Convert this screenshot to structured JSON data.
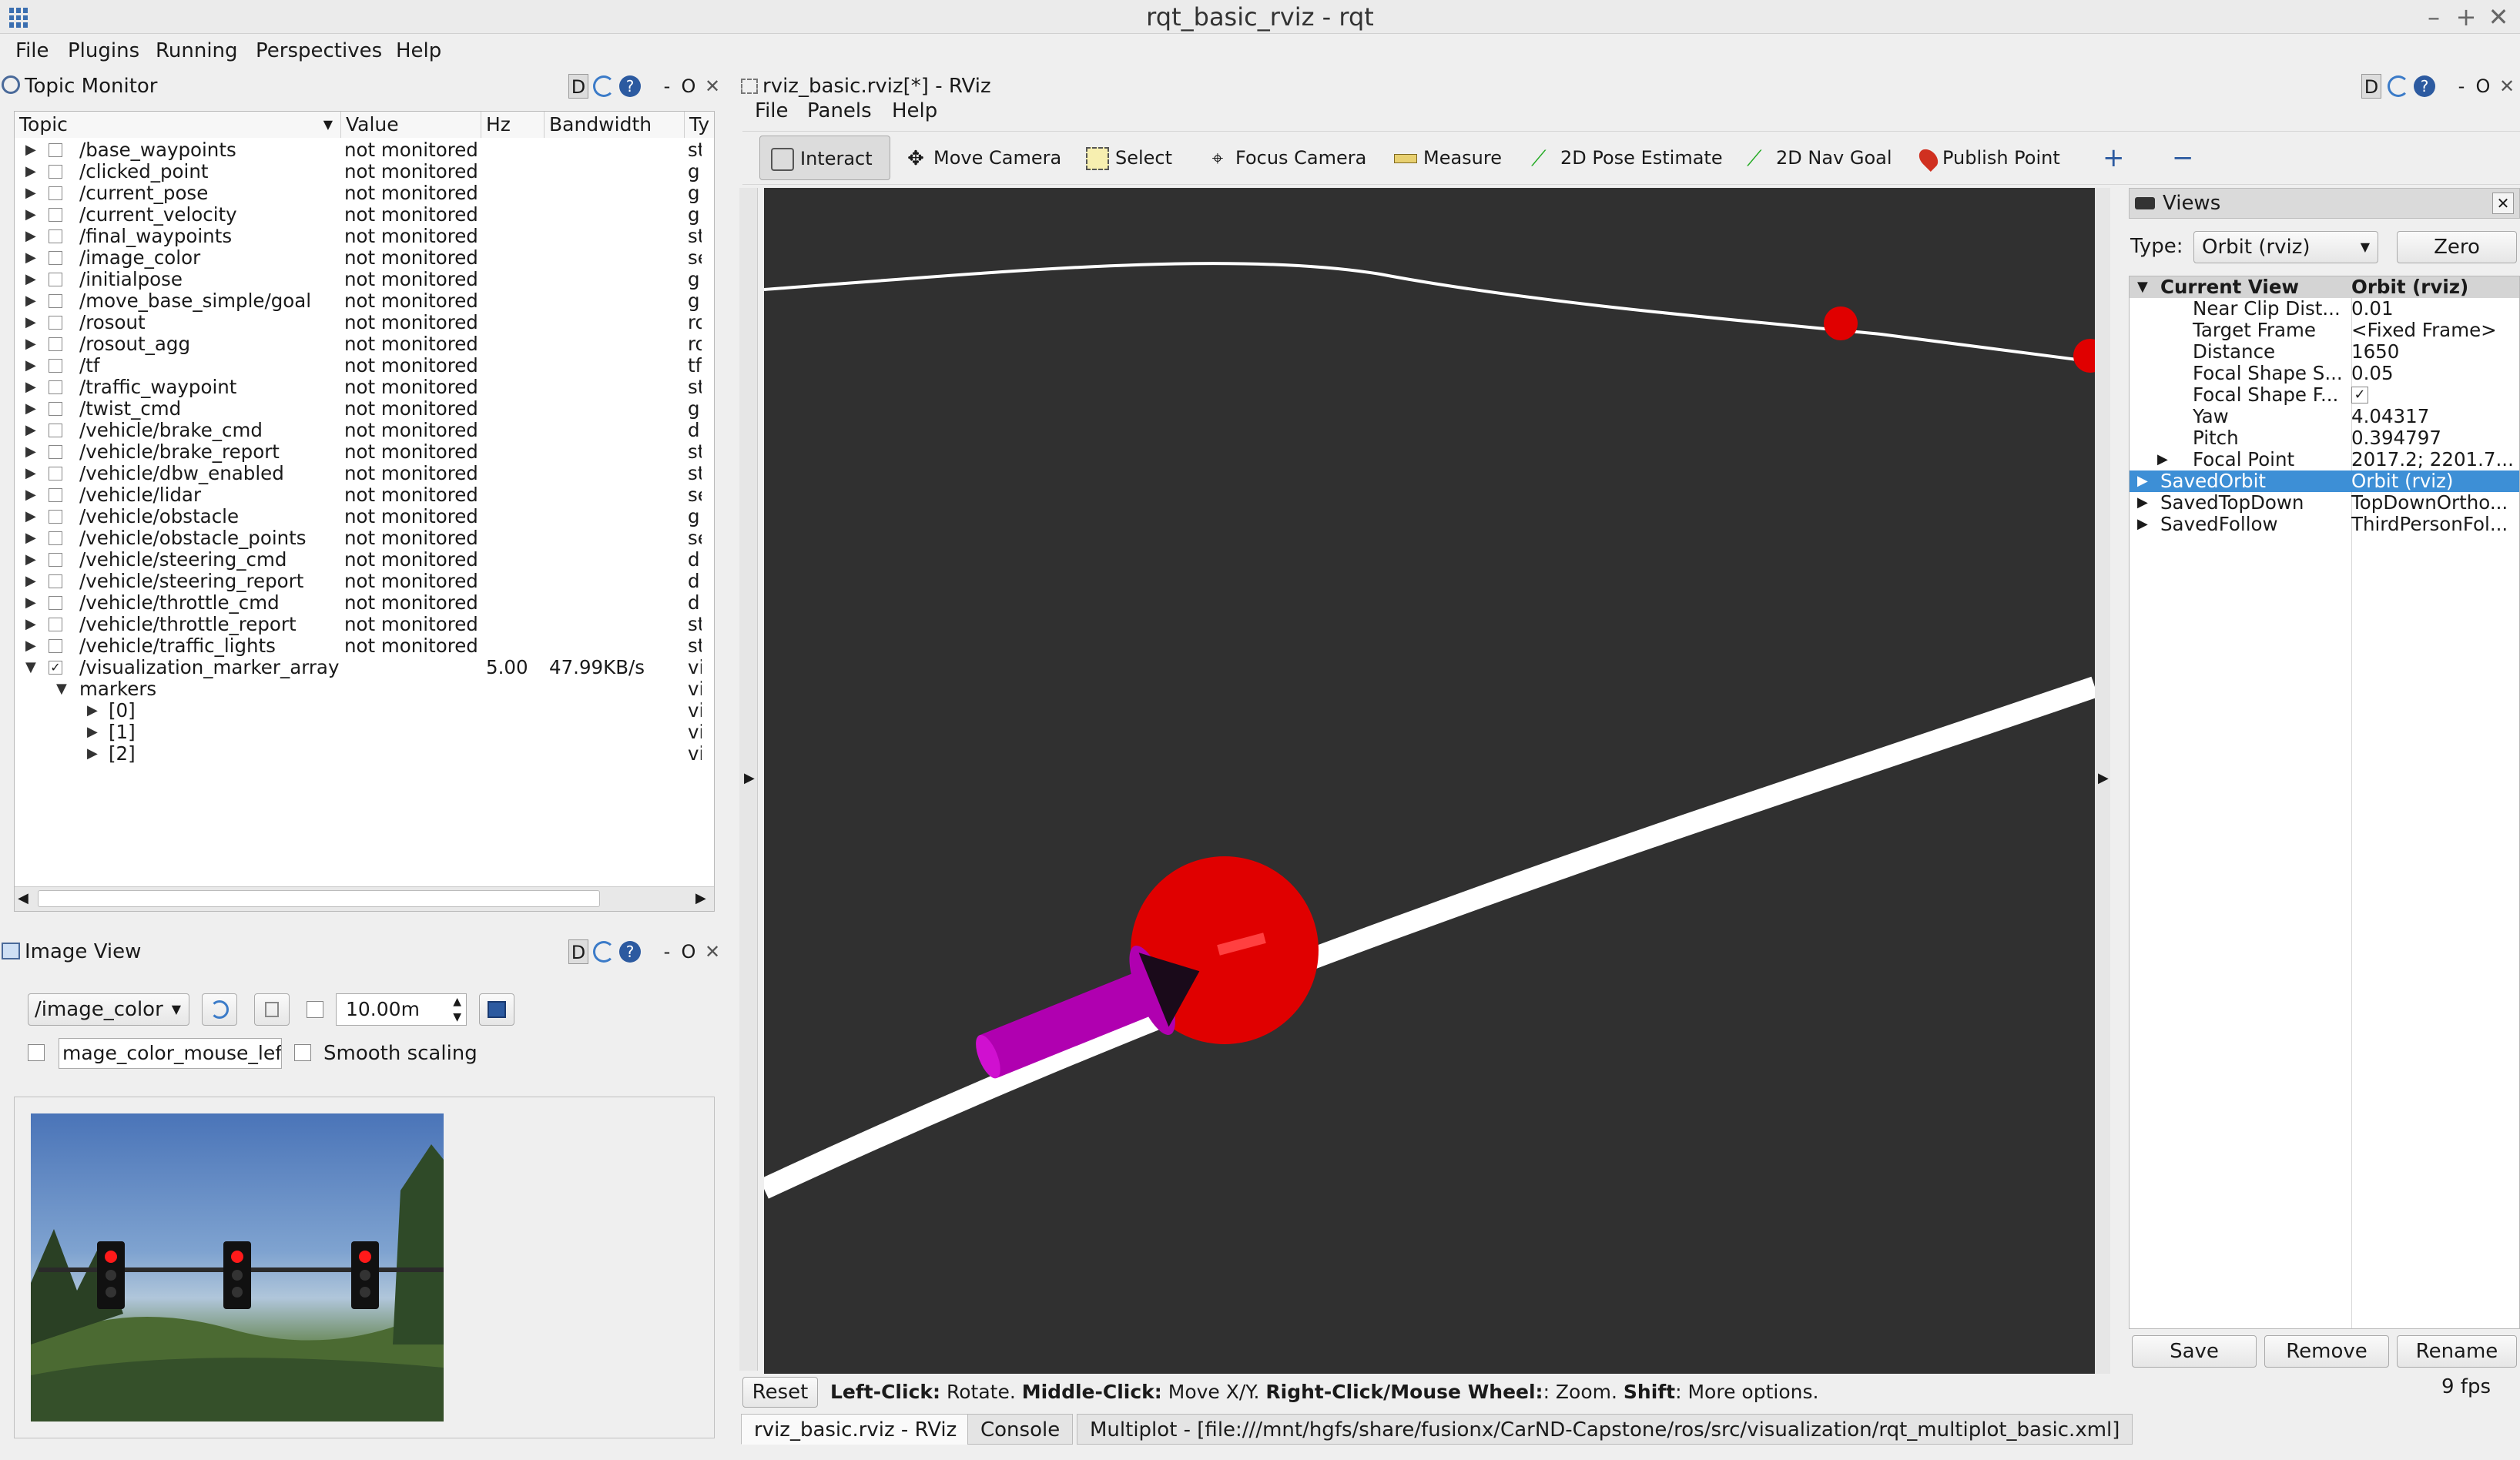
{
  "window": {
    "title": "rqt_basic_rviz - rqt",
    "min": "–",
    "max": "+",
    "close": "✕"
  },
  "menubar": {
    "file": "File",
    "plugins": "Plugins",
    "running": "Running",
    "perspectives": "Perspectives",
    "help": "Help"
  },
  "topic_monitor": {
    "title": "Topic Monitor",
    "dock_d": "D",
    "dock_dash": "-",
    "dock_o": "O",
    "columns": {
      "topic": "Topic",
      "value": "Value",
      "hz": "Hz",
      "bandwidth": "Bandwidth",
      "type": "Ty"
    },
    "rows": [
      {
        "name": "/base_waypoints",
        "value": "not monitored",
        "type": "st"
      },
      {
        "name": "/clicked_point",
        "value": "not monitored",
        "type": "g"
      },
      {
        "name": "/current_pose",
        "value": "not monitored",
        "type": "g"
      },
      {
        "name": "/current_velocity",
        "value": "not monitored",
        "type": "g"
      },
      {
        "name": "/final_waypoints",
        "value": "not monitored",
        "type": "st"
      },
      {
        "name": "/image_color",
        "value": "not monitored",
        "type": "se"
      },
      {
        "name": "/initialpose",
        "value": "not monitored",
        "type": "g"
      },
      {
        "name": "/move_base_simple/goal",
        "value": "not monitored",
        "type": "g"
      },
      {
        "name": "/rosout",
        "value": "not monitored",
        "type": "ro"
      },
      {
        "name": "/rosout_agg",
        "value": "not monitored",
        "type": "ro"
      },
      {
        "name": "/tf",
        "value": "not monitored",
        "type": "tf"
      },
      {
        "name": "/traffic_waypoint",
        "value": "not monitored",
        "type": "st"
      },
      {
        "name": "/twist_cmd",
        "value": "not monitored",
        "type": "g"
      },
      {
        "name": "/vehicle/brake_cmd",
        "value": "not monitored",
        "type": "d"
      },
      {
        "name": "/vehicle/brake_report",
        "value": "not monitored",
        "type": "st"
      },
      {
        "name": "/vehicle/dbw_enabled",
        "value": "not monitored",
        "type": "st"
      },
      {
        "name": "/vehicle/lidar",
        "value": "not monitored",
        "type": "se"
      },
      {
        "name": "/vehicle/obstacle",
        "value": "not monitored",
        "type": "g"
      },
      {
        "name": "/vehicle/obstacle_points",
        "value": "not monitored",
        "type": "se"
      },
      {
        "name": "/vehicle/steering_cmd",
        "value": "not monitored",
        "type": "d"
      },
      {
        "name": "/vehicle/steering_report",
        "value": "not monitored",
        "type": "d"
      },
      {
        "name": "/vehicle/throttle_cmd",
        "value": "not monitored",
        "type": "d"
      },
      {
        "name": "/vehicle/throttle_report",
        "value": "not monitored",
        "type": "st"
      },
      {
        "name": "/vehicle/traffic_lights",
        "value": "not monitored",
        "type": "st"
      }
    ],
    "viz": {
      "name": "/visualization_marker_array",
      "hz": "5.00",
      "bandwidth": "47.99KB/s",
      "type": "vi",
      "check": "✓"
    },
    "markers": {
      "name": "markers",
      "type": "vi",
      "children": [
        "[0]",
        "[1]",
        "[2]"
      ]
    }
  },
  "image_view": {
    "title": "Image View",
    "topic": "/image_color",
    "timeout": "10.00m",
    "mouse_topic": "mage_color_mouse_left",
    "smooth": "Smooth scaling"
  },
  "rviz": {
    "title": "rviz_basic.rviz[*] - RViz",
    "menu": {
      "file": "File",
      "panels": "Panels",
      "help": "Help"
    },
    "tools": {
      "interact": "Interact",
      "move_camera": "Move Camera",
      "select": "Select",
      "focus_camera": "Focus Camera",
      "measure": "Measure",
      "pose_estimate": "2D Pose Estimate",
      "nav_goal": "2D Nav Goal",
      "publish_point": "Publish Point"
    },
    "views": {
      "title": "Views",
      "type_label": "Type:",
      "type_value": "Orbit (rviz)",
      "zero": "Zero",
      "current_view": "Current View",
      "current_view_value": "Orbit (rviz)",
      "props": [
        {
          "k": "Near Clip Dist...",
          "v": "0.01"
        },
        {
          "k": "Target Frame",
          "v": "<Fixed Frame>"
        },
        {
          "k": "Distance",
          "v": "1650"
        },
        {
          "k": "Focal Shape S...",
          "v": "0.05"
        },
        {
          "k": "Focal Shape F...",
          "v": "✓"
        },
        {
          "k": "Yaw",
          "v": "4.04317"
        },
        {
          "k": "Pitch",
          "v": "0.394797"
        },
        {
          "k": "Focal Point",
          "v": "2017.2; 2201.7..."
        }
      ],
      "saved": [
        {
          "k": "SavedOrbit",
          "v": "Orbit (rviz)"
        },
        {
          "k": "SavedTopDown",
          "v": "TopDownOrtho..."
        },
        {
          "k": "SavedFollow",
          "v": "ThirdPersonFol..."
        }
      ],
      "save": "Save",
      "remove": "Remove",
      "rename": "Rename",
      "fps": "9 fps"
    },
    "status": {
      "reset": "Reset",
      "lc": "Left-Click:",
      "lc_t": " Rotate. ",
      "mc": "Middle-Click:",
      "mc_t": " Move X/Y. ",
      "rc": "Right-Click/Mouse Wheel:",
      "rc_t": ": Zoom. ",
      "sh": "Shift",
      "sh_t": ": More options."
    }
  },
  "tabs": {
    "t1": "rviz_basic.rviz - RViz",
    "t2": "Console",
    "t3": "Multiplot - [file:///mnt/hgfs/share/fusionx/CarND-Capstone/ros/src/visualization/rqt_multiplot_basic.xml]"
  },
  "colors": {
    "selected": "#3d8fd6",
    "viewport_bg": "#303030",
    "marker_red": "#e00000",
    "arrow_magenta": "#c000c0"
  }
}
